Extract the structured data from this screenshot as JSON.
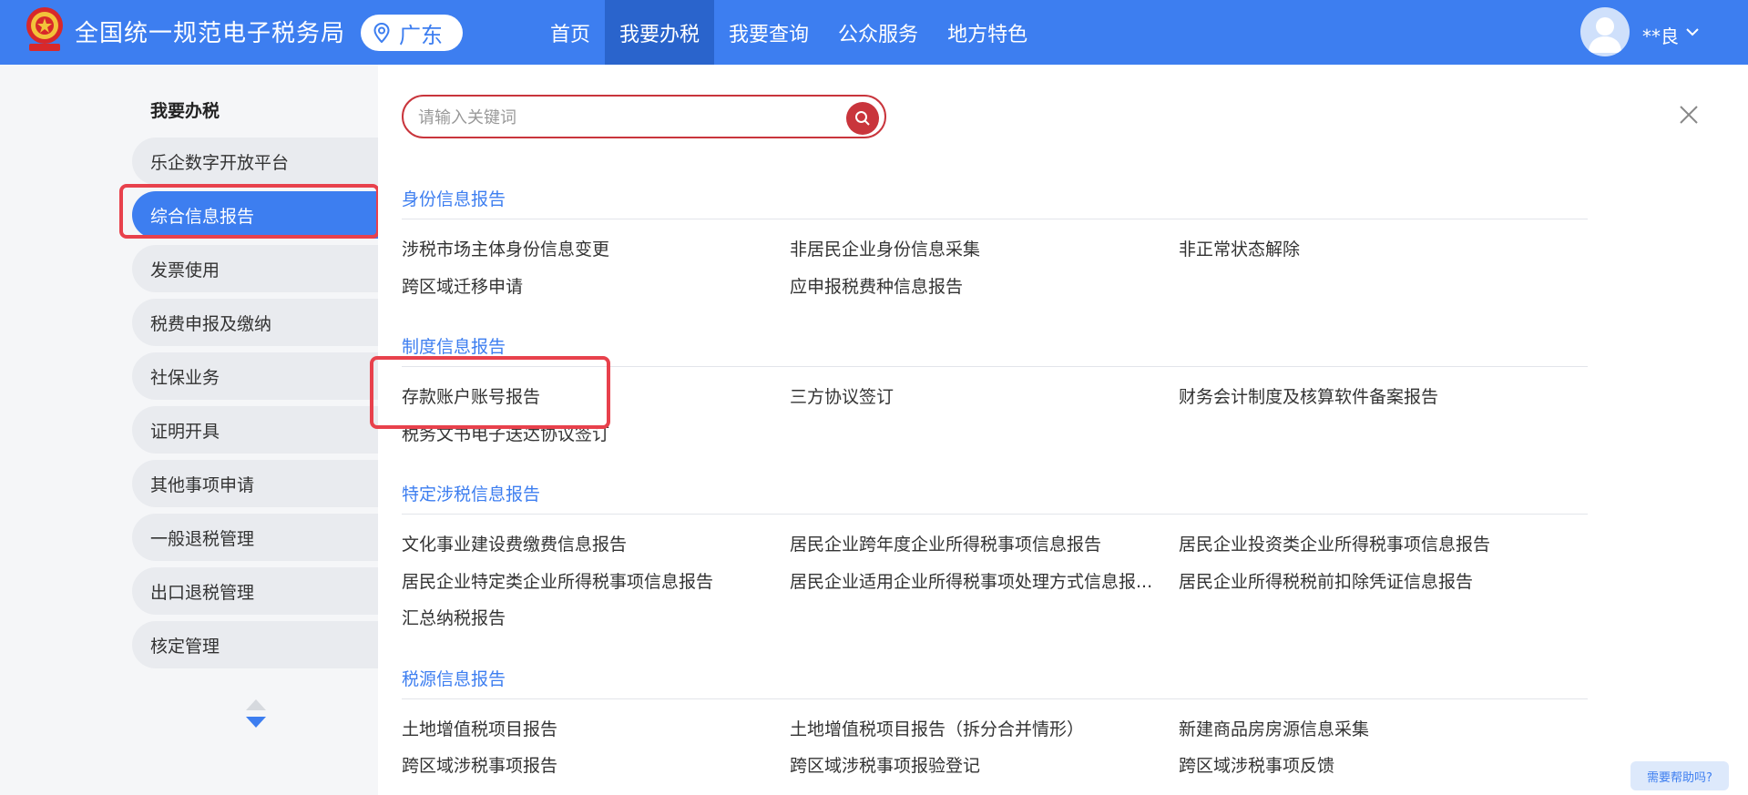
{
  "header": {
    "title": "全国统一规范电子税务局",
    "region": "广东",
    "nav": [
      "首页",
      "我要办税",
      "我要查询",
      "公众服务",
      "地方特色"
    ],
    "active_nav": 1,
    "user_name": "**良",
    "brand_color": "#3d7ef0"
  },
  "sidebar": {
    "heading": "我要办税",
    "items": [
      "乐企数字开放平台",
      "综合信息报告",
      "发票使用",
      "税费申报及缴纳",
      "社保业务",
      "证明开具",
      "其他事项申请",
      "一般退税管理",
      "出口退税管理",
      "核定管理"
    ],
    "active_index": 1
  },
  "search": {
    "placeholder": "请输入关键词"
  },
  "sections": [
    {
      "title": "身份信息报告",
      "links": [
        "涉税市场主体身份信息变更",
        "非居民企业身份信息采集",
        "非正常状态解除",
        "跨区域迁移申请",
        "应申报税费种信息报告"
      ]
    },
    {
      "title": "制度信息报告",
      "links": [
        "存款账户账号报告",
        "三方协议签订",
        "财务会计制度及核算软件备案报告",
        "税务文书电子送达协议签订"
      ]
    },
    {
      "title": "特定涉税信息报告",
      "links": [
        "文化事业建设费缴费信息报告",
        "居民企业跨年度企业所得税事项信息报告",
        "居民企业投资类企业所得税事项信息报告",
        "居民企业特定类企业所得税事项信息报告",
        "居民企业适用企业所得税事项处理方式信息报...",
        "居民企业所得税税前扣除凭证信息报告",
        "汇总纳税报告"
      ]
    },
    {
      "title": "税源信息报告",
      "links": [
        "土地增值税项目报告",
        "土地增值税项目报告（拆分合并情形）",
        "新建商品房房源信息采集",
        "跨区域涉税事项报告",
        "跨区域涉税事项报验登记",
        "跨区域涉税事项反馈"
      ]
    }
  ],
  "help": {
    "label": "需要帮助吗?"
  }
}
